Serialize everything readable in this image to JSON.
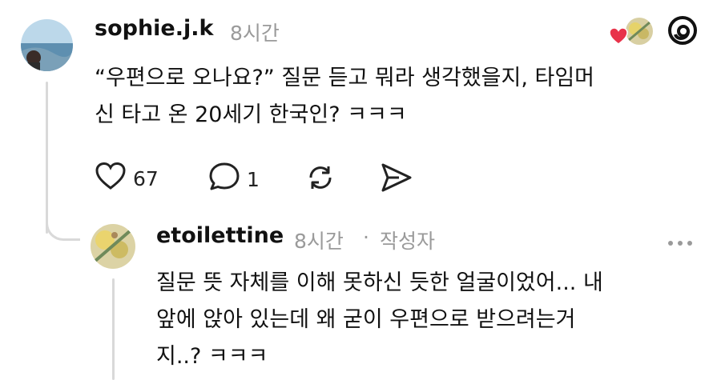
{
  "post": {
    "username": "sophie.j.k",
    "time": "8시간",
    "text_line1": "“우편으로 오나요?” 질문 듣고 뭐라 생각했을지, 타임머",
    "text_line2": "신 타고 온 20세기 한국인? ㅋㅋㅋ",
    "like_count": "67",
    "reply_count": "1",
    "icons": [
      "heart-icon",
      "comment-icon",
      "repost-icon",
      "share-icon",
      "threads-logo-icon",
      "liked-by-heart-icon"
    ]
  },
  "reply": {
    "username": "etoilettine",
    "time": "8시간",
    "separator": "·",
    "author_badge": "작성자",
    "text_line1": "질문 뜻 자체를 이해 못하신 듯한 얼굴이었어... 내",
    "text_line2": "앞에 앉아 있는데 왜 굳이 우편으로 받으려는거",
    "text_line3": "지..? ㅋㅋㅋ",
    "icons": [
      "more-options-icon"
    ]
  },
  "colors": {
    "text": "#111111",
    "muted": "#9a9a9a",
    "heart": "#e8334a",
    "thread_line": "#d9d9d9"
  }
}
